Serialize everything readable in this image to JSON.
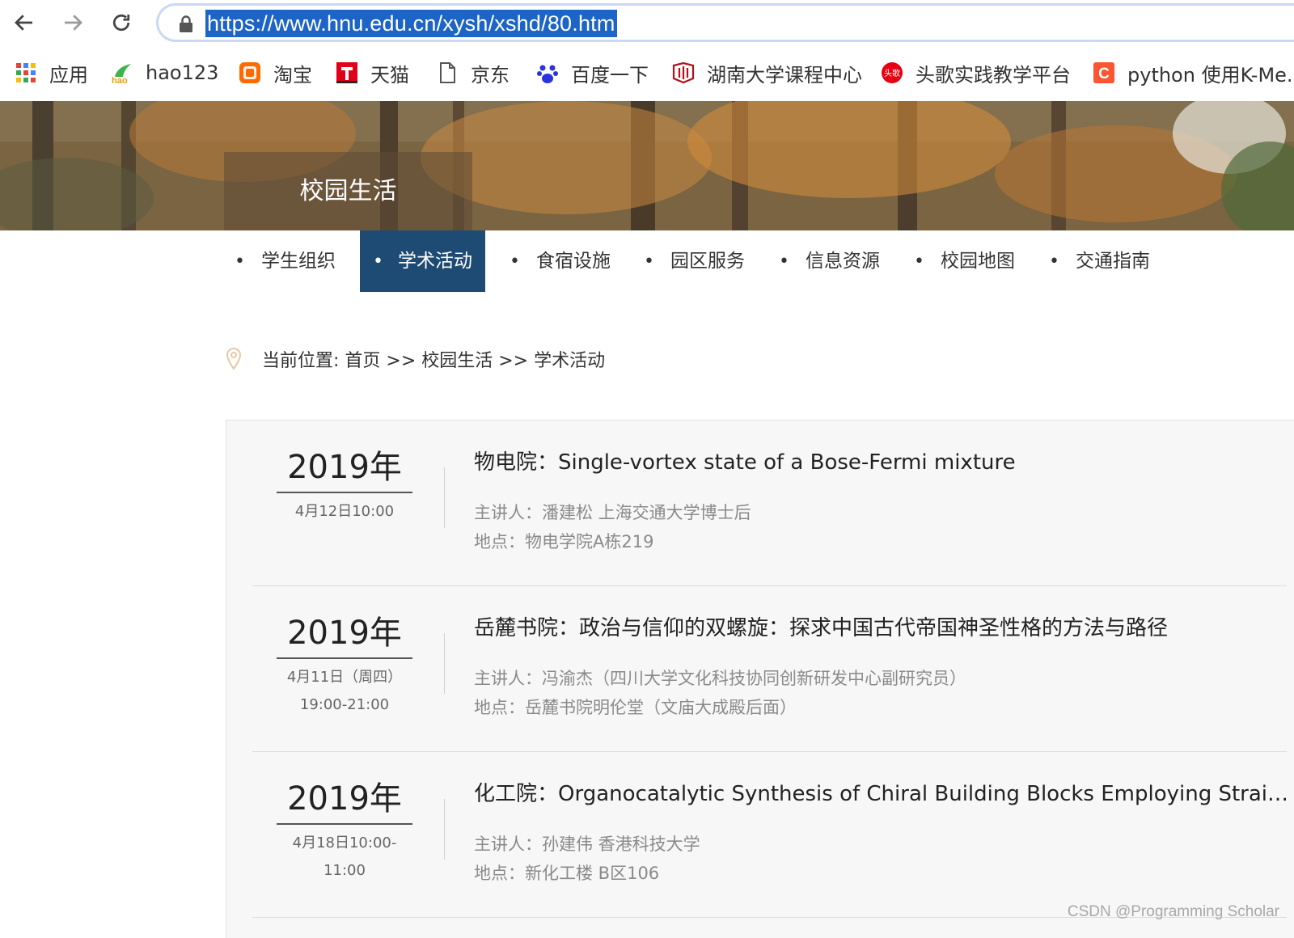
{
  "browser": {
    "url": "https://www.hnu.edu.cn/xysh/xshd/80.htm",
    "bookmarks": [
      {
        "label": "应用",
        "icon": "apps-grid-icon"
      },
      {
        "label": "hao123",
        "icon": "hao123-icon"
      },
      {
        "label": "淘宝",
        "icon": "taobao-icon"
      },
      {
        "label": "天猫",
        "icon": "tmall-icon"
      },
      {
        "label": "京东",
        "icon": "page-icon"
      },
      {
        "label": "百度一下",
        "icon": "baidu-paw-icon"
      },
      {
        "label": "湖南大学课程中心",
        "icon": "hnu-logo-icon"
      },
      {
        "label": "头歌实践教学平台",
        "icon": "educoder-icon"
      },
      {
        "label": "python 使用K-Me...",
        "icon": "csdn-c-icon"
      }
    ]
  },
  "banner": {
    "title": "校园生活"
  },
  "subnav": {
    "items": [
      "学生组织",
      "学术活动",
      "食宿设施",
      "园区服务",
      "信息资源",
      "校园地图",
      "交通指南"
    ],
    "active": "学术活动"
  },
  "breadcrumb": {
    "text": "当前位置: 首页 >> 校园生活 >> 学术活动"
  },
  "events": [
    {
      "year": "2019年",
      "date_lines": [
        "4月12日10:00"
      ],
      "title": "物电院：Single-vortex state of a Bose-Fermi mixture",
      "speaker": "主讲人：潘建松 上海交通大学博士后",
      "location": "地点：物电学院A栋219"
    },
    {
      "year": "2019年",
      "date_lines": [
        "4月11日（周四）",
        "19:00-21:00"
      ],
      "title": "岳麓书院：政治与信仰的双螺旋：探求中国古代帝国神圣性格的方法与路径",
      "speaker": "主讲人：冯渝杰（四川大学文化科技协同创新研发中心副研究员）",
      "location": "地点：岳麓书院明伦堂（文庙大成殿后面）"
    },
    {
      "year": "2019年",
      "date_lines": [
        "4月18日10:00-",
        "11:00"
      ],
      "title": "化工院：Organocatalytic Synthesis of Chiral Building Blocks Employing Strained Rin...",
      "speaker": "主讲人：孙建伟 香港科技大学",
      "location": "地点：新化工楼 B区106"
    }
  ],
  "watermark": "CSDN @Programming Scholar",
  "colors": {
    "active_nav": "#1e4b74",
    "url_highlight": "#1c64c6"
  }
}
